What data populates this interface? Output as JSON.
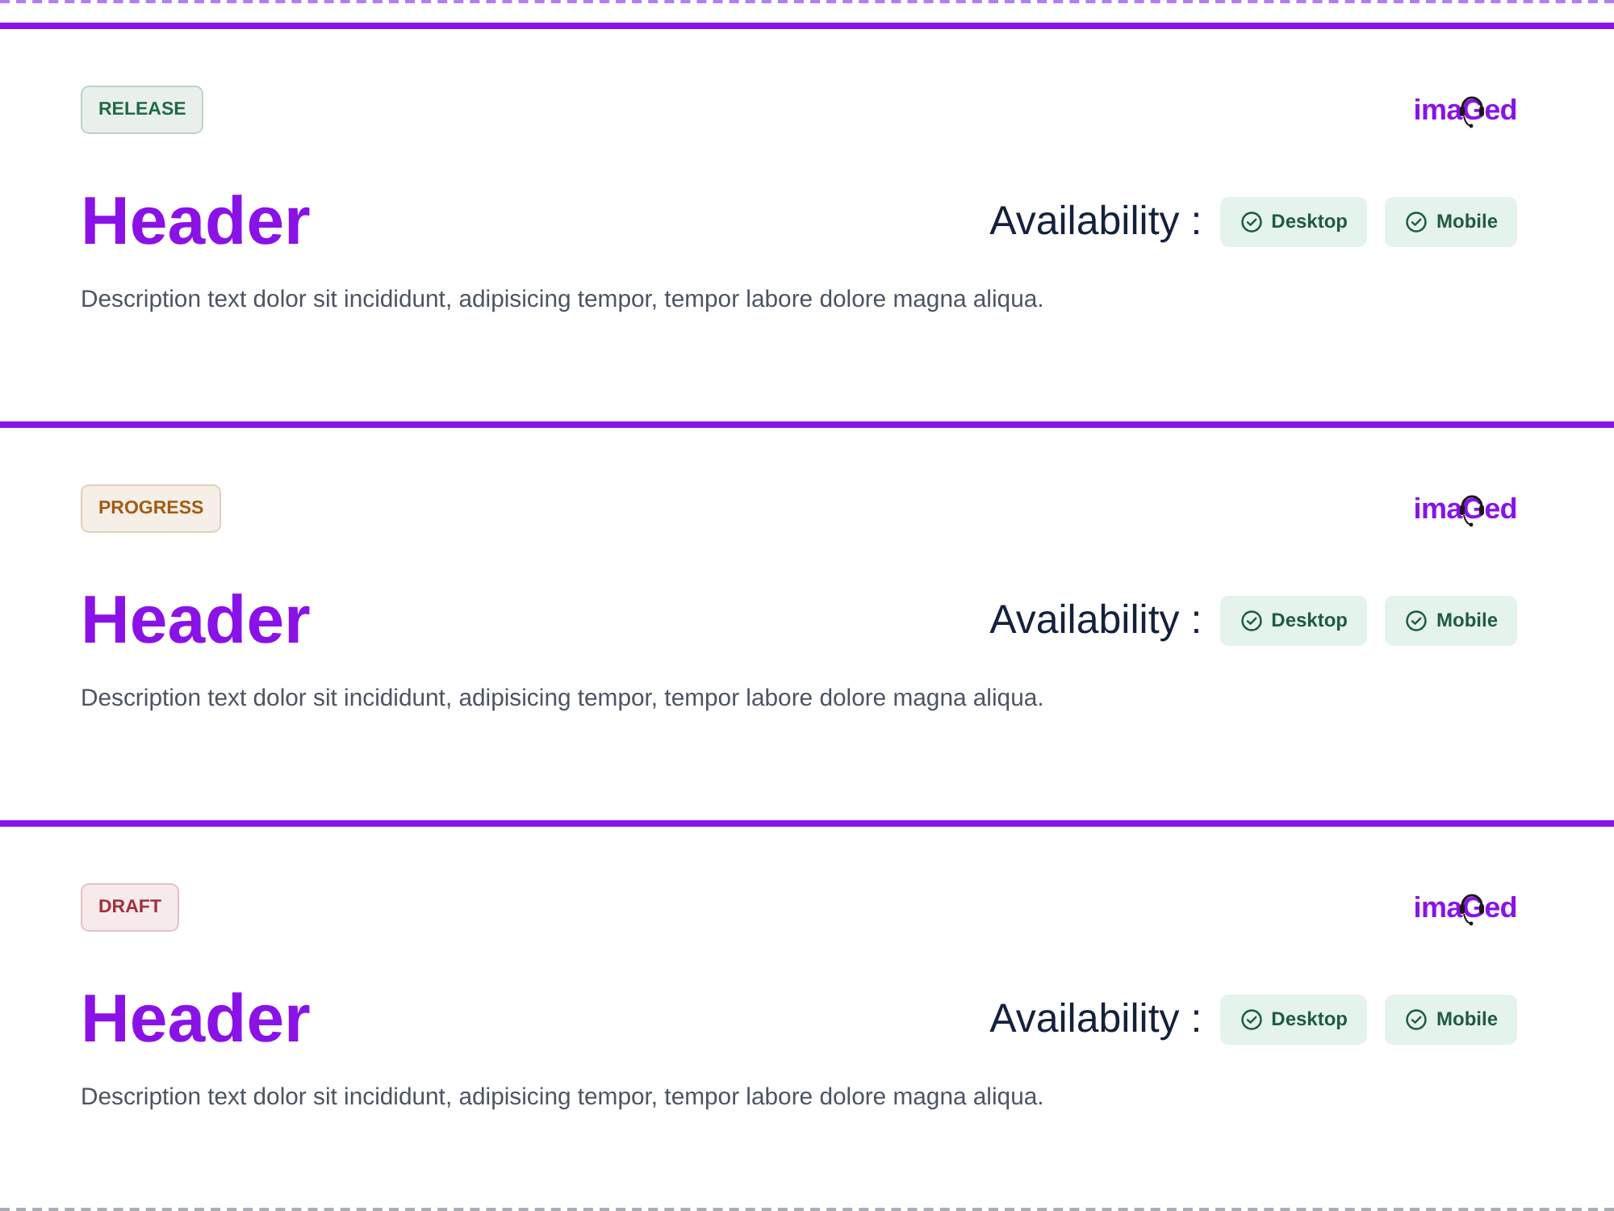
{
  "sections": [
    {
      "status": {
        "label": "RELEASE",
        "color": "#1f6b45"
      },
      "logo": {
        "text": "imaGed"
      },
      "title": "Header",
      "availability": {
        "label": "Availability :",
        "platforms": [
          "Desktop",
          "Mobile"
        ]
      },
      "description": "Description text dolor sit incididunt, adipisicing tempor, tempor labore dolore magna aliqua."
    },
    {
      "status": {
        "label": "PROGRESS",
        "color": "#a35a12"
      },
      "logo": {
        "text": "imaGed"
      },
      "title": "Header",
      "availability": {
        "label": "Availability :",
        "platforms": [
          "Desktop",
          "Mobile"
        ]
      },
      "description": "Description text dolor sit incididunt, adipisicing tempor, tempor labore dolore magna aliqua."
    },
    {
      "status": {
        "label": "DRAFT",
        "color": "#a1303a"
      },
      "logo": {
        "text": "imaGed"
      },
      "title": "Header",
      "availability": {
        "label": "Availability :",
        "platforms": [
          "Desktop",
          "Mobile"
        ]
      },
      "description": "Description text dolor sit incididunt, adipisicing tempor, tempor labore dolore magna aliqua."
    }
  ]
}
